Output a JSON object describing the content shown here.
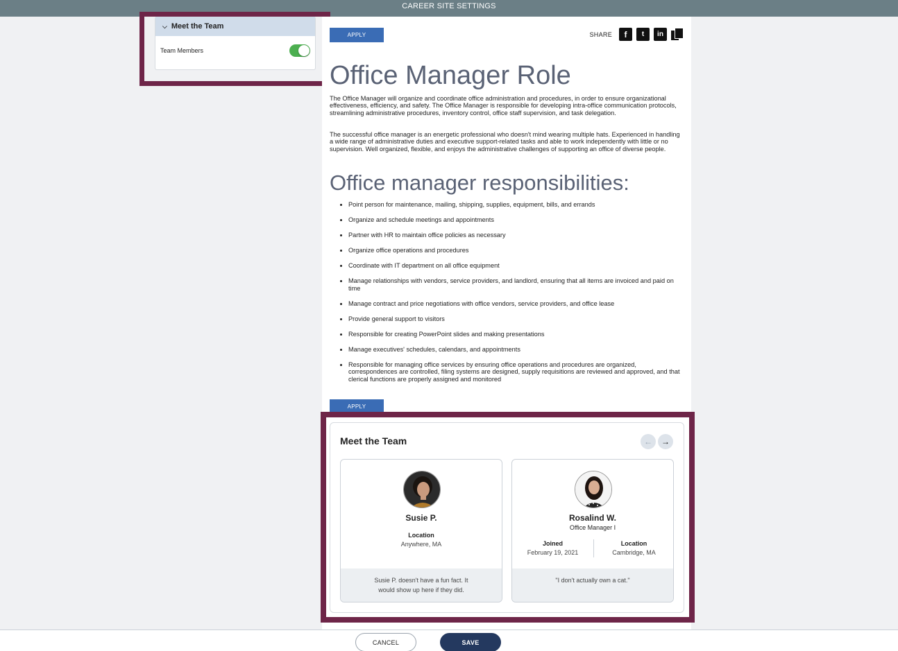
{
  "topbar": {
    "title": "CAREER SITE SETTINGS"
  },
  "settings": {
    "section_title": "Meet the Team",
    "toggle_label": "Team Members",
    "toggle_on": true
  },
  "job": {
    "apply_label": "APPLY",
    "share_label": "SHARE",
    "title": "Office Manager Role",
    "intro_paragraphs": [
      "The Office Manager will organize and coordinate office administration and procedures, in order to ensure organizational effectiveness, efficiency, and safety. The Office Manager is responsible for developing intra-office communication protocols, streamlining administrative procedures, inventory control, office staff supervision, and task delegation.",
      "The successful office manager is an energetic professional who doesn't mind wearing multiple hats. Experienced in handling a wide range of administrative duties and executive support-related tasks and able to work independently with little or no supervision. Well organized, flexible, and enjoys the administrative challenges of supporting an office of diverse people."
    ],
    "responsibilities_title": "Office manager responsibilities:",
    "responsibilities": [
      "Point person for maintenance, mailing, shipping, supplies, equipment, bills, and errands",
      "Organize and schedule meetings and appointments",
      "Partner with HR to maintain office policies as necessary",
      "Organize office operations and procedures",
      "Coordinate with IT department on all office equipment",
      "Manage relationships with vendors, service providers, and landlord, ensuring that all items are invoiced and paid on time",
      "Manage contract and price negotiations with office vendors, service providers, and office lease",
      "Provide general support to visitors",
      "Responsible for creating PowerPoint slides and making presentations",
      "Manage executives' schedules, calendars, and appointments",
      "Responsible for managing office services by ensuring office operations and procedures are organized, correspondences are controlled, filing systems are designed, supply requisitions are reviewed and approved, and that clerical functions are properly assigned and monitored"
    ]
  },
  "team": {
    "title": "Meet the Team",
    "members": [
      {
        "name": "Susie P.",
        "location_label": "Location",
        "location": "Anywhere, MA",
        "fun_fact": "Susie P. doesn't have a fun fact. It would show up here if they did."
      },
      {
        "name": "Rosalind W.",
        "role": "Office Manager I",
        "joined_label": "Joined",
        "joined": "February 19, 2021",
        "location_label": "Location",
        "location": "Cambridge, MA",
        "fun_fact": "\"I don't actually own a cat.\""
      }
    ]
  },
  "footer": {
    "cancel_label": "CANCEL",
    "save_label": "SAVE"
  }
}
